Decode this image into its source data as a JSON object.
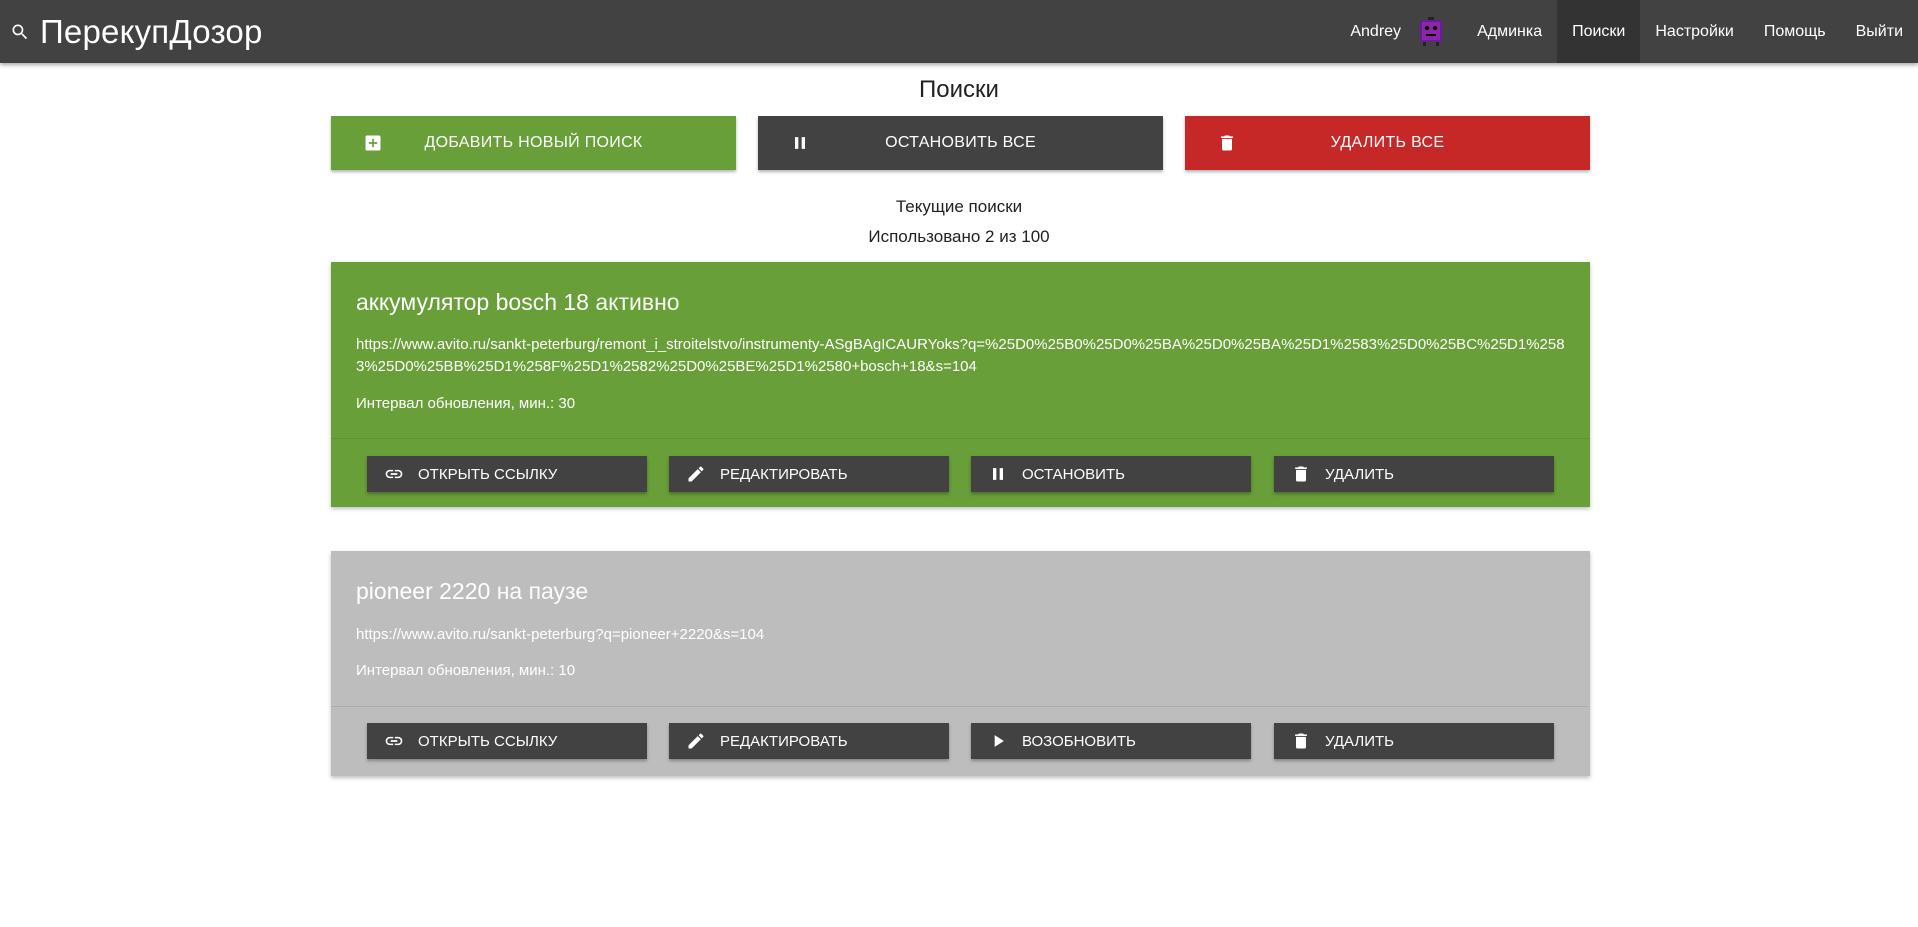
{
  "app": {
    "title": "ПерекупДозор",
    "search_icon": "search-icon"
  },
  "nav": {
    "user_name": "Andrey",
    "avatar_icon": "avatar-icon",
    "links": [
      "Админка",
      "Поиски",
      "Настройки",
      "Помощь",
      "Выйти"
    ],
    "active": "Поиски"
  },
  "page": {
    "title": "Поиски",
    "current_label": "Текущие поиски",
    "usage_label": "Использовано 2 из 100"
  },
  "toolbar": {
    "add_label": "ДОБАВИТЬ НОВЫЙ ПОИСК",
    "add_icon": "add-box-icon",
    "stop_all_label": "ОСТАНОВИТЬ ВСЕ",
    "stop_all_icon": "pause-icon",
    "delete_all_label": "УДАЛИТЬ ВСЕ",
    "delete_all_icon": "trash-icon"
  },
  "colors": {
    "navbar": "#424242",
    "active_card": "#689f38",
    "paused_card": "#bdbdbd",
    "danger": "#c62828",
    "dark_button": "#424242"
  },
  "searches": [
    {
      "name": "аккумулятор bosch 18",
      "status": "активно",
      "url": "https://www.avito.ru/sankt-peterburg/remont_i_stroitelstvo/instrumenty-ASgBAgICAURYoks?q=%25D0%25B0%25D0%25BA%25D0%25BA%25D1%2583%25D0%25BC%25D1%2583%25D0%25BB%25D1%258F%25D1%2582%25D0%25BE%25D1%2580+bosch+18&s=104",
      "interval_label": "Интервал обновления, мин.: 30",
      "actions": {
        "open": "ОТКРЫТЬ ССЫЛКУ",
        "edit": "РЕДАКТИРОВАТЬ",
        "toggle": "ОСТАНОВИТЬ",
        "delete": "УДАЛИТЬ"
      }
    },
    {
      "name": "pioneer 2220",
      "status": "на паузе",
      "url": "https://www.avito.ru/sankt-peterburg?q=pioneer+2220&s=104",
      "interval_label": "Интервал обновления, мин.: 10",
      "actions": {
        "open": "ОТКРЫТЬ ССЫЛКУ",
        "edit": "РЕДАКТИРОВАТЬ",
        "toggle": "ВОЗОБНОВИТЬ",
        "delete": "УДАЛИТЬ"
      }
    }
  ]
}
